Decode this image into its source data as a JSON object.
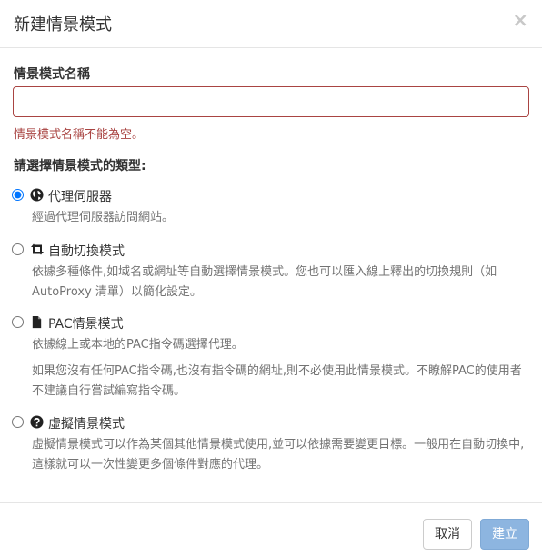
{
  "dialog": {
    "title": "新建情景模式",
    "close_glyph": "×"
  },
  "form": {
    "name_label": "情景模式名稱",
    "name_value": "",
    "name_placeholder": "",
    "name_error": "情景模式名稱不能為空。",
    "type_label": "請選擇情景模式的類型:"
  },
  "options": [
    {
      "label": "代理伺服器",
      "icon": "globe-icon",
      "selected": true,
      "help": [
        "經過代理伺服器訪問網站。"
      ]
    },
    {
      "label": "自動切換模式",
      "icon": "retweet-icon",
      "selected": false,
      "help": [
        "依據多種條件,如域名或網址等自動選擇情景模式。您也可以匯入線上釋出的切換規則（如 AutoProxy 清單）以簡化設定。"
      ]
    },
    {
      "label": "PAC情景模式",
      "icon": "file-icon",
      "selected": false,
      "help": [
        "依據線上或本地的PAC指令碼選擇代理。",
        "如果您沒有任何PAC指令碼,也沒有指令碼的網址,則不必使用此情景模式。不瞭解PAC的使用者不建議自行嘗試編寫指令碼。"
      ]
    },
    {
      "label": "虛擬情景模式",
      "icon": "question-circle-icon",
      "selected": false,
      "help": [
        "虛擬情景模式可以作為某個其他情景模式使用,並可以依據需要變更目標。一般用在自動切換中,這樣就可以一次性變更多個條件對應的代理。"
      ]
    }
  ],
  "footer": {
    "cancel_label": "取消",
    "create_label": "建立"
  },
  "colors": {
    "error": "#a94442",
    "primary_disabled": "#8db5e0",
    "help_text": "#737373"
  }
}
